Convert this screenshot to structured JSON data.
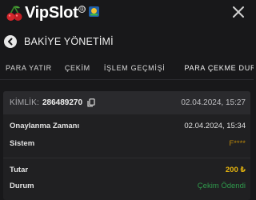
{
  "brand": {
    "name": "VipSlot",
    "registered_mark": "®"
  },
  "header": {
    "title": "BAKİYE YÖNETİMİ"
  },
  "tabs": [
    {
      "label": "PARA YATIR"
    },
    {
      "label": "ÇEKİM"
    },
    {
      "label": "İŞLEM GEÇMİŞİ"
    },
    {
      "label": "PARA ÇEKME DURUMU",
      "active": true
    }
  ],
  "transaction": {
    "id_label": "KİMLİK:",
    "id_value": "286489270",
    "created_at": "02.04.2024, 15:27",
    "rows": [
      {
        "label": "Onaylanma Zamanı",
        "value": "02.04.2024, 15:34"
      },
      {
        "label": "Sistem",
        "value": "F****"
      },
      {
        "label": "Tutar",
        "value": "200 ₺"
      },
      {
        "label": "Durum",
        "value": "Çekim Ödendi"
      }
    ]
  },
  "colors": {
    "background": "#18181a",
    "accent_red": "#d3262c",
    "amount": "#e8b60e",
    "status_paid": "#2f9a4c",
    "system_masked": "#b8860b"
  },
  "icons": [
    "cherry-logo-icon",
    "award-badge-icon",
    "close-icon",
    "back-arrow-icon",
    "copy-icon"
  ]
}
